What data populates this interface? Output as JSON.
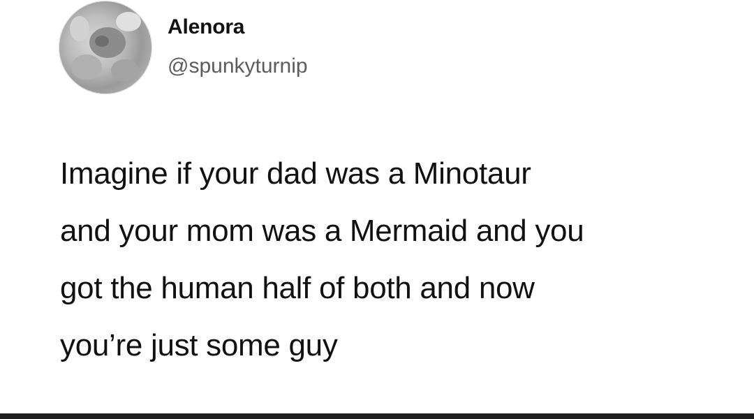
{
  "user": {
    "display_name": "Alenora",
    "handle": "@spunkyturnip"
  },
  "tweet": {
    "lines": [
      "Imagine if your dad was a Minotaur",
      "and your mom was a Mermaid and you",
      "got the human half of both and now",
      "you’re just some guy"
    ]
  },
  "icons": {
    "avatar": "profile-avatar-photo"
  },
  "colors": {
    "background": "#ffffff",
    "text": "#111111",
    "handle": "#5c5c5c",
    "bottom_bar": "#1e1e1e"
  }
}
